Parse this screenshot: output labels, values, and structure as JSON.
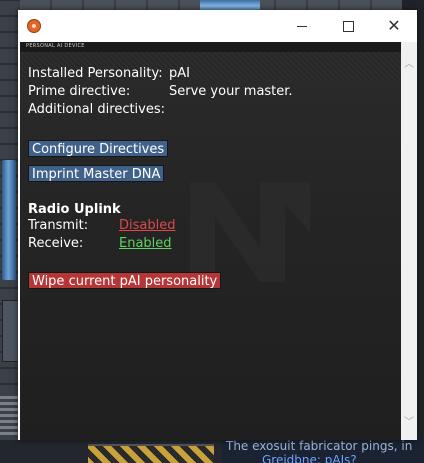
{
  "background": {
    "chat_line1": "The exosuit fabricator pings, in",
    "chat_line2": "Greidbne: pAIs?"
  },
  "window": {
    "controls": {
      "minimize": "minimize-icon",
      "maximize": "maximize-icon",
      "close": "close-icon"
    },
    "header_text": "PERSONAL AI DEVICE"
  },
  "pai": {
    "personality_label": "Installed Personality:",
    "personality_value": "pAI",
    "prime_label": "Prime directive:",
    "prime_value": "Serve your master.",
    "additional_label": "Additional directives:",
    "additional_value": ""
  },
  "buttons": {
    "configure": "Configure Directives",
    "imprint": "Imprint Master DNA",
    "wipe": "Wipe current pAI personality"
  },
  "radio": {
    "title": "Radio Uplink",
    "transmit_label": "Transmit:",
    "transmit_value": "Disabled",
    "receive_label": "Receive:",
    "receive_value": "Enabled"
  },
  "colors": {
    "button": "#40628a",
    "danger_button": "#b43636",
    "disabled_link": "#e04848",
    "enabled_link": "#5ed35e",
    "panel_bg": "#252525"
  }
}
